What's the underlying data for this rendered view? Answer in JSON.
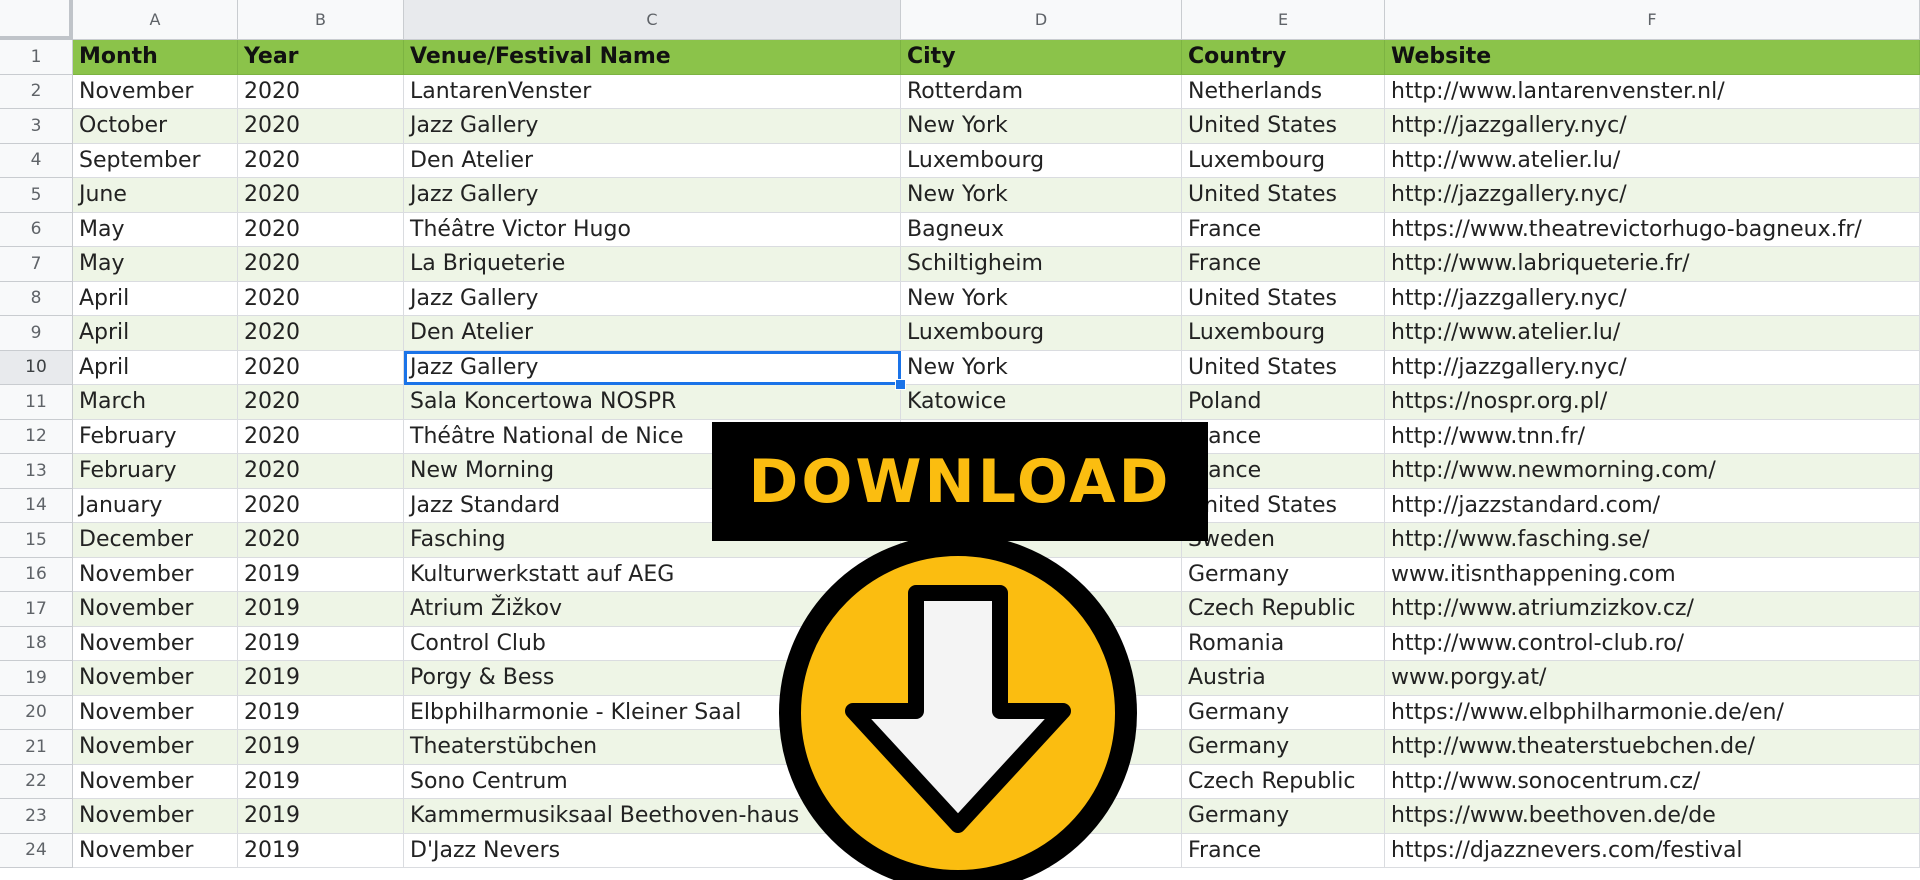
{
  "columns": [
    "A",
    "B",
    "C",
    "D",
    "E",
    "F"
  ],
  "rows": [
    [
      "Month",
      "Year",
      "Venue/Festival Name",
      "City",
      "Country",
      "Website"
    ],
    [
      "November",
      "2020",
      "LantarenVenster",
      "Rotterdam",
      "Netherlands",
      "http://www.lantarenvenster.nl/"
    ],
    [
      "October",
      "2020",
      "Jazz Gallery",
      "New York",
      "United States",
      "http://jazzgallery.nyc/"
    ],
    [
      "September",
      "2020",
      "Den Atelier",
      "Luxembourg",
      "Luxembourg",
      "http://www.atelier.lu/"
    ],
    [
      "June",
      "2020",
      "Jazz Gallery",
      "New York",
      "United States",
      "http://jazzgallery.nyc/"
    ],
    [
      "May",
      "2020",
      "Théâtre Victor Hugo",
      "Bagneux",
      "France",
      "https://www.theatrevictorhugo-bagneux.fr/"
    ],
    [
      "May",
      "2020",
      "La Briqueterie",
      "Schiltigheim",
      "France",
      "http://www.labriqueterie.fr/"
    ],
    [
      "April",
      "2020",
      "Jazz Gallery",
      "New York",
      "United States",
      "http://jazzgallery.nyc/"
    ],
    [
      "April",
      "2020",
      "Den Atelier",
      "Luxembourg",
      "Luxembourg",
      "http://www.atelier.lu/"
    ],
    [
      "April",
      "2020",
      "Jazz Gallery",
      "New York",
      "United States",
      "http://jazzgallery.nyc/"
    ],
    [
      "March",
      "2020",
      "Sala Koncertowa NOSPR",
      "Katowice",
      "Poland",
      "https://nospr.org.pl/"
    ],
    [
      "February",
      "2020",
      "Théâtre National de Nice",
      "",
      "France",
      "http://www.tnn.fr/"
    ],
    [
      "February",
      "2020",
      "New Morning",
      "",
      "France",
      "http://www.newmorning.com/"
    ],
    [
      "January",
      "2020",
      "Jazz Standard",
      "",
      "United States",
      "http://jazzstandard.com/"
    ],
    [
      "December",
      "2020",
      "Fasching",
      "",
      "Sweden",
      "http://www.fasching.se/"
    ],
    [
      "November",
      "2019",
      "Kulturwerkstatt auf AEG",
      "",
      "Germany",
      "www.itisnthappening.com"
    ],
    [
      "November",
      "2019",
      "Atrium Žižkov",
      "",
      "Czech Republic",
      "http://www.atriumzizkov.cz/"
    ],
    [
      "November",
      "2019",
      "Control Club",
      "",
      "Romania",
      "http://www.control-club.ro/"
    ],
    [
      "November",
      "2019",
      "Porgy & Bess",
      "",
      "Austria",
      "www.porgy.at/"
    ],
    [
      "November",
      "2019",
      "Elbphilharmonie - Kleiner Saal",
      "",
      "Germany",
      "https://www.elbphilharmonie.de/en/"
    ],
    [
      "November",
      "2019",
      "Theaterstübchen",
      "",
      "Germany",
      "http://www.theaterstuebchen.de/"
    ],
    [
      "November",
      "2019",
      "Sono Centrum",
      "",
      "Czech Republic",
      "http://www.sonocentrum.cz/"
    ],
    [
      "November",
      "2019",
      "Kammermusiksaal Beethoven-haus",
      "",
      "Germany",
      "https://www.beethoven.de/de"
    ],
    [
      "November",
      "2019",
      "D'Jazz Nevers",
      "",
      "France",
      "https://djazznevers.com/festival"
    ]
  ],
  "selection": {
    "row": 10,
    "column": "C"
  },
  "overlay": {
    "banner_text": "DOWNLOAD",
    "icon": "download-arrow-icon"
  },
  "colors": {
    "header_green": "#8bc34a",
    "band_green": "#eef5e6",
    "selection_blue": "#1a73e8",
    "overlay_yellow": "#fbbd10"
  }
}
